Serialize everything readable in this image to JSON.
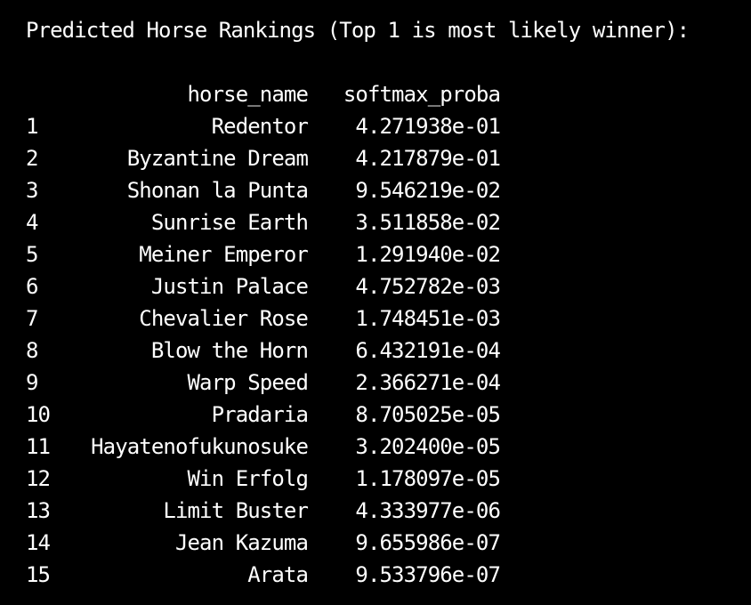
{
  "terminal": {
    "heading": "Predicted Horse Rankings (Top 1 is most likely winner):",
    "columns": {
      "horse_name": "horse_name",
      "softmax_proba": "softmax_proba"
    },
    "rows": [
      {
        "index": "1",
        "horse_name": "Redentor",
        "softmax_proba": "4.271938e-01"
      },
      {
        "index": "2",
        "horse_name": "Byzantine Dream",
        "softmax_proba": "4.217879e-01"
      },
      {
        "index": "3",
        "horse_name": "Shonan la Punta",
        "softmax_proba": "9.546219e-02"
      },
      {
        "index": "4",
        "horse_name": "Sunrise Earth",
        "softmax_proba": "3.511858e-02"
      },
      {
        "index": "5",
        "horse_name": "Meiner Emperor",
        "softmax_proba": "1.291940e-02"
      },
      {
        "index": "6",
        "horse_name": "Justin Palace",
        "softmax_proba": "4.752782e-03"
      },
      {
        "index": "7",
        "horse_name": "Chevalier Rose",
        "softmax_proba": "1.748451e-03"
      },
      {
        "index": "8",
        "horse_name": "Blow the Horn",
        "softmax_proba": "6.432191e-04"
      },
      {
        "index": "9",
        "horse_name": "Warp Speed",
        "softmax_proba": "2.366271e-04"
      },
      {
        "index": "10",
        "horse_name": "Pradaria",
        "softmax_proba": "8.705025e-05"
      },
      {
        "index": "11",
        "horse_name": "Hayatenofukunosuke",
        "softmax_proba": "3.202400e-05"
      },
      {
        "index": "12",
        "horse_name": "Win Erfolg",
        "softmax_proba": "1.178097e-05"
      },
      {
        "index": "13",
        "horse_name": "Limit Buster",
        "softmax_proba": "4.333977e-06"
      },
      {
        "index": "14",
        "horse_name": "Jean Kazuma",
        "softmax_proba": "9.655986e-07"
      },
      {
        "index": "15",
        "horse_name": "Arata",
        "softmax_proba": "9.533796e-07"
      }
    ]
  },
  "colors": {
    "background": "#000000",
    "text": "#ffffff"
  }
}
